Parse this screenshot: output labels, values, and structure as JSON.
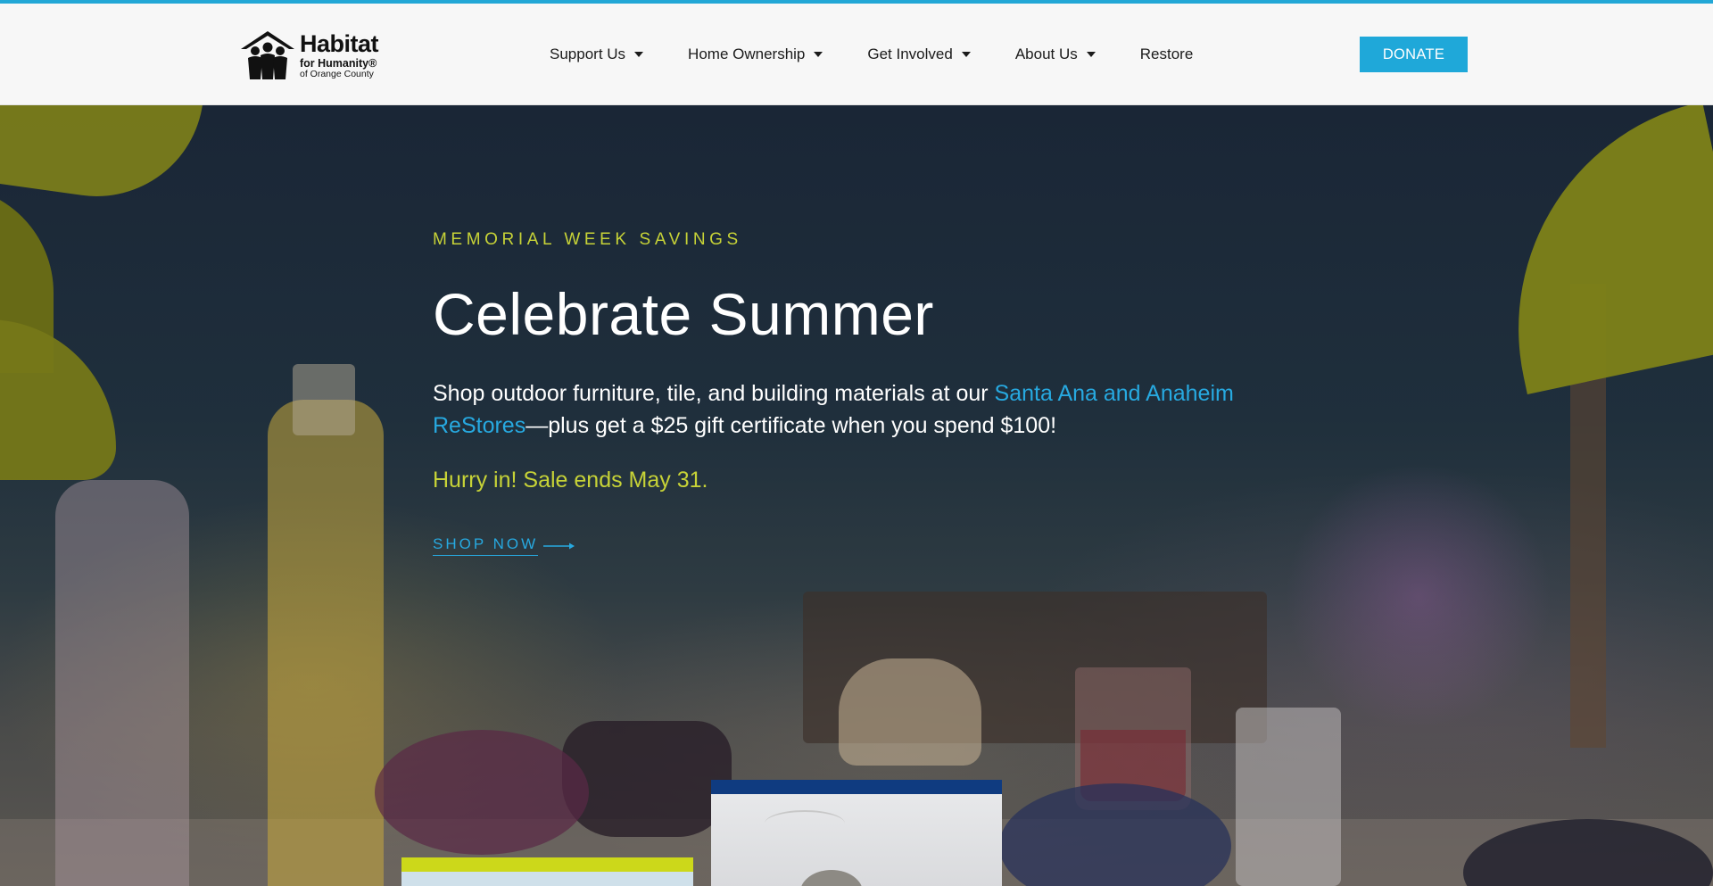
{
  "header": {
    "logo": {
      "line1": "Habitat",
      "line2": "for Humanity®",
      "line3": "of Orange County"
    },
    "nav": [
      {
        "label": "Support Us",
        "has_dropdown": true
      },
      {
        "label": "Home Ownership",
        "has_dropdown": true
      },
      {
        "label": "Get Involved",
        "has_dropdown": true
      },
      {
        "label": "About Us",
        "has_dropdown": true
      },
      {
        "label": "Restore",
        "has_dropdown": false
      }
    ],
    "donate_label": "DONATE"
  },
  "hero": {
    "eyebrow": "MEMORIAL WEEK SAVINGS",
    "title": "Celebrate Summer",
    "desc_before": "Shop outdoor furniture, tile, and building materials at our ",
    "desc_link": "Santa Ana and Anaheim ReStores",
    "desc_after": "—plus get a $25 gift certificate when you spend $100!",
    "hurry": "Hurry in! Sale ends May 31.",
    "cta_label": "SHOP NOW",
    "cta_icon": "arrow-right-icon"
  },
  "colors": {
    "accent_blue": "#1fa8d9",
    "accent_lime": "#c7d337",
    "link_blue": "#27a9e0",
    "card_navy": "#0f3b80",
    "card_lime": "#ccd81a"
  }
}
